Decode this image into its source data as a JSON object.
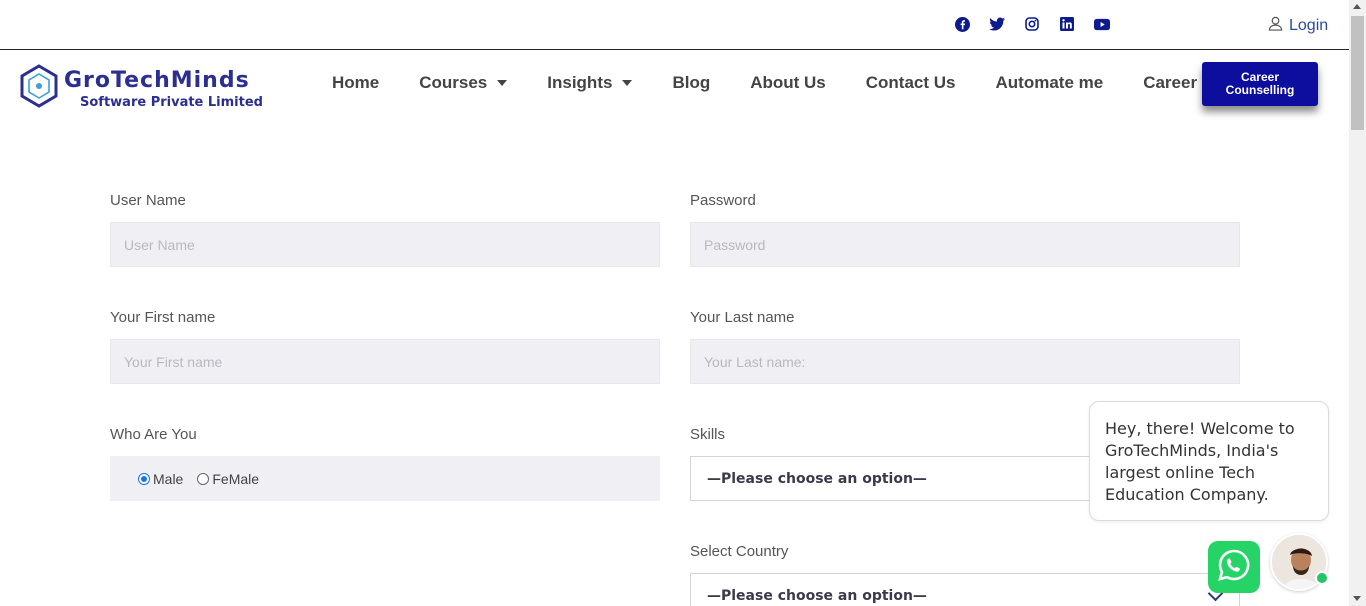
{
  "topbar": {
    "social_icons": [
      "facebook-icon",
      "twitter-icon",
      "instagram-icon",
      "linkedin-icon",
      "youtube-icon"
    ],
    "login_label": "Login"
  },
  "header": {
    "logo_title": "GroTechMinds",
    "logo_subtitle": "Software Private Limited",
    "nav": [
      {
        "label": "Home"
      },
      {
        "label": "Courses"
      },
      {
        "label": "Insights"
      },
      {
        "label": "Blog"
      },
      {
        "label": "About Us"
      },
      {
        "label": "Contact Us"
      },
      {
        "label": "Automate me"
      },
      {
        "label": "Career"
      }
    ],
    "cta_line1": "Career",
    "cta_line2": "Counselling"
  },
  "form": {
    "username": {
      "label": "User Name",
      "placeholder": "User Name"
    },
    "password": {
      "label": "Password",
      "placeholder": "Password"
    },
    "first_name": {
      "label": "Your First name",
      "placeholder": "Your First name"
    },
    "last_name": {
      "label": "Your Last name",
      "placeholder": "Your Last name:"
    },
    "who_are_you": {
      "label": "Who Are You",
      "options": [
        "Male",
        "FeMale"
      ],
      "selected": "Male"
    },
    "skills": {
      "label": "Skills",
      "value": "—Please choose an option—"
    },
    "country": {
      "label": "Select Country",
      "value": "—Please choose an option—"
    }
  },
  "chat": {
    "message": "Hey, there! Welcome to GroTechMinds, India's largest online Tech Education Company."
  },
  "colors": {
    "brand": "#2b2f8f",
    "cta_bg": "#0d0d9e",
    "input_bg": "#f0f0f4",
    "whatsapp": "#25d366"
  }
}
